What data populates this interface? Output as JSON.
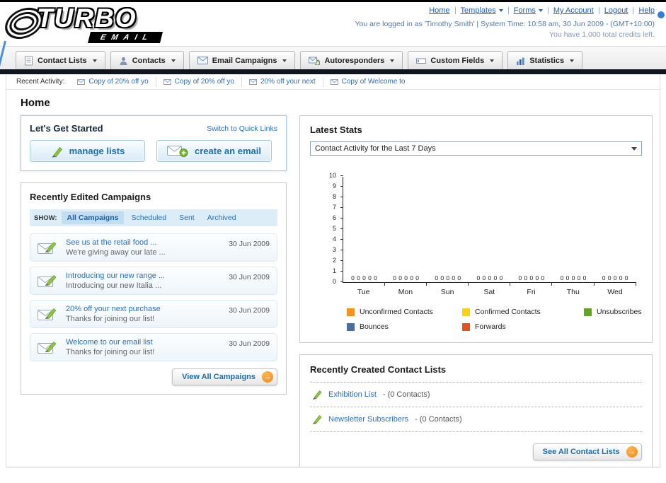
{
  "header": {
    "logo_text": "TURBO",
    "logo_sub": "EMAIL",
    "nav_links": [
      "Home",
      "Templates",
      "Forms",
      "My Account",
      "Logout",
      "Help"
    ],
    "login_info": "You are logged in as 'Timothy Smith' | System Time: 10:58 am, 30 Jun 2009 - (GMT+10:00)",
    "credits_info": "You have 1,000 total credits left."
  },
  "nav_tabs": [
    {
      "label": "Contact Lists"
    },
    {
      "label": "Contacts"
    },
    {
      "label": "Email Campaigns"
    },
    {
      "label": "Autoresponders"
    },
    {
      "label": "Custom Fields"
    },
    {
      "label": "Statistics"
    }
  ],
  "recent_activity": {
    "label": "Recent Activity:",
    "items": [
      "Copy of 20% off yo",
      "Copy of 20% off yo",
      "20% off your next",
      "Copy of Welcome to"
    ]
  },
  "page_title": "Home",
  "get_started": {
    "title": "Let's Get Started",
    "switch_link": "Switch to Quick Links",
    "manage_lists_label": "manage lists",
    "create_email_label": "create an email"
  },
  "campaigns": {
    "title": "Recently Edited Campaigns",
    "show_label": "SHOW:",
    "filters": [
      "All Campaigns",
      "Scheduled",
      "Sent",
      "Archived"
    ],
    "items": [
      {
        "title": "See us at the retail food ...",
        "subtitle": "We're giving away our late ...",
        "date": "30 Jun 2009"
      },
      {
        "title": "Introducing our new range ...",
        "subtitle": "Introducing our new Italia ...",
        "date": "30 Jun 2009"
      },
      {
        "title": "20% off your next purchase",
        "subtitle": "Thanks for joining our list!",
        "date": "30 Jun 2009"
      },
      {
        "title": "Welcome to our email list",
        "subtitle": "Thanks for joining our list!",
        "date": "30 Jun 2009"
      }
    ],
    "view_all_label": "View All Campaigns"
  },
  "latest_stats": {
    "title": "Latest Stats",
    "dropdown_value": "Contact Activity for the Last 7 Days",
    "legend": [
      {
        "label": "Unconfirmed Contacts",
        "color": "#f7941d"
      },
      {
        "label": "Confirmed Contacts",
        "color": "#fdd017"
      },
      {
        "label": "Unsubscribes",
        "color": "#62a420"
      },
      {
        "label": "Bounces",
        "color": "#4a6da7"
      },
      {
        "label": "Forwards",
        "color": "#e8501e"
      }
    ]
  },
  "contact_lists": {
    "title": "Recently Created Contact Lists",
    "items": [
      {
        "name": "Exhibition List",
        "suffix": "- (0 Contacts)"
      },
      {
        "name": "Newsletter Subscribers",
        "suffix": "- (0 Contacts)"
      }
    ],
    "see_all_label": "See All Contact Lists"
  },
  "icons": {
    "forward_arrow": "→"
  },
  "chart_data": {
    "type": "bar",
    "title": "Contact Activity for the Last 7 Days",
    "categories": [
      "Tue",
      "Mon",
      "Sun",
      "Sat",
      "Fri",
      "Thu",
      "Wed"
    ],
    "series": [
      {
        "name": "Unconfirmed Contacts",
        "color": "#f7941d",
        "values": [
          0,
          0,
          0,
          0,
          0,
          0,
          0
        ]
      },
      {
        "name": "Confirmed Contacts",
        "color": "#fdd017",
        "values": [
          0,
          0,
          0,
          0,
          0,
          0,
          0
        ]
      },
      {
        "name": "Unsubscribes",
        "color": "#62a420",
        "values": [
          0,
          0,
          0,
          0,
          0,
          0,
          0
        ]
      },
      {
        "name": "Bounces",
        "color": "#4a6da7",
        "values": [
          0,
          0,
          0,
          0,
          0,
          0,
          0
        ]
      },
      {
        "name": "Forwards",
        "color": "#e8501e",
        "values": [
          0,
          0,
          0,
          0,
          0,
          0,
          0
        ]
      }
    ],
    "ylim": [
      0,
      10
    ],
    "yticks": [
      0,
      1,
      2,
      3,
      4,
      5,
      6,
      7,
      8,
      9,
      10
    ],
    "data_labels": true,
    "grid": false,
    "legend_position": "bottom"
  }
}
